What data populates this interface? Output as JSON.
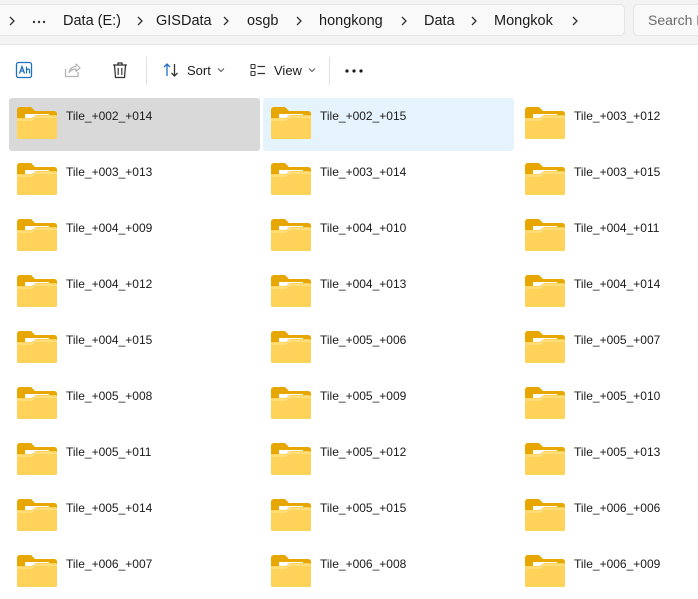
{
  "breadcrumb": {
    "items": [
      "Data (E:)",
      "GISData",
      "osgb",
      "hongkong",
      "Data",
      "Mongkok"
    ]
  },
  "search": {
    "placeholder": "Search Mongkok"
  },
  "toolbar": {
    "sort_label": "Sort",
    "view_label": "View"
  },
  "files": [
    {
      "name": "Tile_+002_+014",
      "state": "selected"
    },
    {
      "name": "Tile_+002_+015",
      "state": "hovered"
    },
    {
      "name": "Tile_+003_+012"
    },
    {
      "name": "Tile_+003_+013"
    },
    {
      "name": "Tile_+003_+014"
    },
    {
      "name": "Tile_+003_+015"
    },
    {
      "name": "Tile_+004_+009"
    },
    {
      "name": "Tile_+004_+010"
    },
    {
      "name": "Tile_+004_+011"
    },
    {
      "name": "Tile_+004_+012"
    },
    {
      "name": "Tile_+004_+013"
    },
    {
      "name": "Tile_+004_+014"
    },
    {
      "name": "Tile_+004_+015"
    },
    {
      "name": "Tile_+005_+006"
    },
    {
      "name": "Tile_+005_+007"
    },
    {
      "name": "Tile_+005_+008"
    },
    {
      "name": "Tile_+005_+009"
    },
    {
      "name": "Tile_+005_+010"
    },
    {
      "name": "Tile_+005_+011"
    },
    {
      "name": "Tile_+005_+012"
    },
    {
      "name": "Tile_+005_+013"
    },
    {
      "name": "Tile_+005_+014"
    },
    {
      "name": "Tile_+005_+015"
    },
    {
      "name": "Tile_+006_+006"
    },
    {
      "name": "Tile_+006_+007"
    },
    {
      "name": "Tile_+006_+008"
    },
    {
      "name": "Tile_+006_+009"
    }
  ],
  "colors": {
    "folder_back": "#e8a600",
    "folder_front": "#ffd35a",
    "selected": "#d9d9d9",
    "hovered": "#e5f3fd"
  },
  "icons": [
    "chevron-right-icon",
    "more-dots-icon",
    "ai-translate-icon",
    "share-icon",
    "delete-icon",
    "sort-icon",
    "view-icon",
    "chevron-down-icon",
    "folder-icon"
  ]
}
